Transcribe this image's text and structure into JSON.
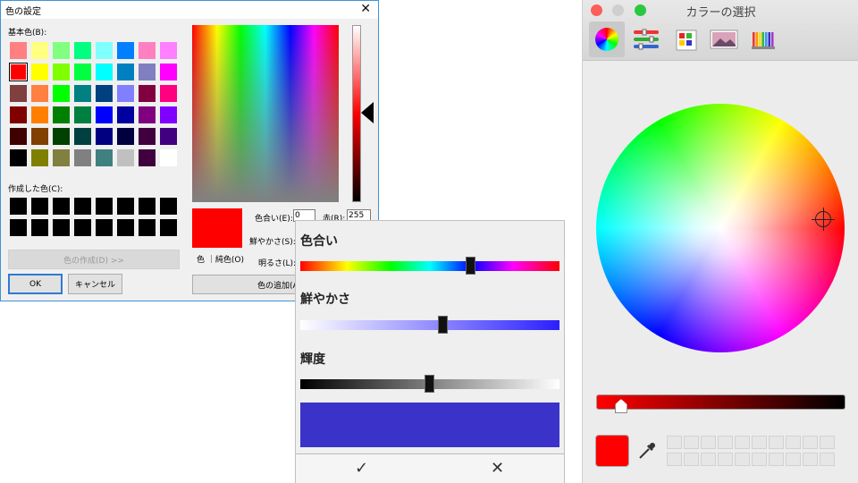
{
  "windows_dialog": {
    "title": "色の設定",
    "close_glyph": "✕",
    "basic_colors_label": "基本色(B):",
    "basic_colors": [
      "#ff8080",
      "#ffff80",
      "#80ff80",
      "#00ff80",
      "#80ffff",
      "#0080ff",
      "#ff80c0",
      "#ff80ff",
      "#ff0000",
      "#ffff00",
      "#80ff00",
      "#00ff40",
      "#00ffff",
      "#0080c0",
      "#8080c0",
      "#ff00ff",
      "#804040",
      "#ff8040",
      "#00ff00",
      "#008080",
      "#004080",
      "#8080ff",
      "#800040",
      "#ff0080",
      "#800000",
      "#ff8000",
      "#008000",
      "#008040",
      "#0000ff",
      "#0000a0",
      "#800080",
      "#8000ff",
      "#400000",
      "#804000",
      "#004000",
      "#004040",
      "#000080",
      "#000040",
      "#400040",
      "#400080",
      "#000000",
      "#808000",
      "#808040",
      "#808080",
      "#408080",
      "#c0c0c0",
      "#400040",
      "#ffffff"
    ],
    "selected_index": 8,
    "custom_colors_label": "作成した色(C):",
    "custom_colors": [
      "#000000",
      "#000000",
      "#000000",
      "#000000",
      "#000000",
      "#000000",
      "#000000",
      "#000000",
      "#000000",
      "#000000",
      "#000000",
      "#000000",
      "#000000",
      "#000000",
      "#000000",
      "#000000"
    ],
    "define_button": "色の作成(D) >>",
    "ok_button": "OK",
    "cancel_button": "キャンセル",
    "color_solid_label": "色 ｜純色(O)",
    "hue_label": "色合い(E):",
    "hue_value": "0",
    "sat_label": "鮮やかさ(S):",
    "lum_label": "明るさ(L):",
    "red_label": "赤(R):",
    "red_value": "255",
    "add_button": "色の追加(A)",
    "current_color": "#ff0000"
  },
  "slider_popup": {
    "hue_title": "色合い",
    "hue_value": 0.66,
    "sat_title": "鮮やかさ",
    "sat_value": 0.55,
    "bright_title": "輝度",
    "bright_value": 0.5,
    "result_color": "#3b33c9",
    "confirm_glyph": "✓",
    "cancel_glyph": "✕"
  },
  "mac_picker": {
    "title": "カラーの選択",
    "tabs": [
      "color-wheel-icon",
      "sliders-icon",
      "palettes-icon",
      "image-palette-icon",
      "pencils-icon"
    ],
    "active_tab": 0,
    "brightness_value": 0.1,
    "current_color": "#ff0000",
    "swatch_rows": 2,
    "swatch_cols": 10
  }
}
